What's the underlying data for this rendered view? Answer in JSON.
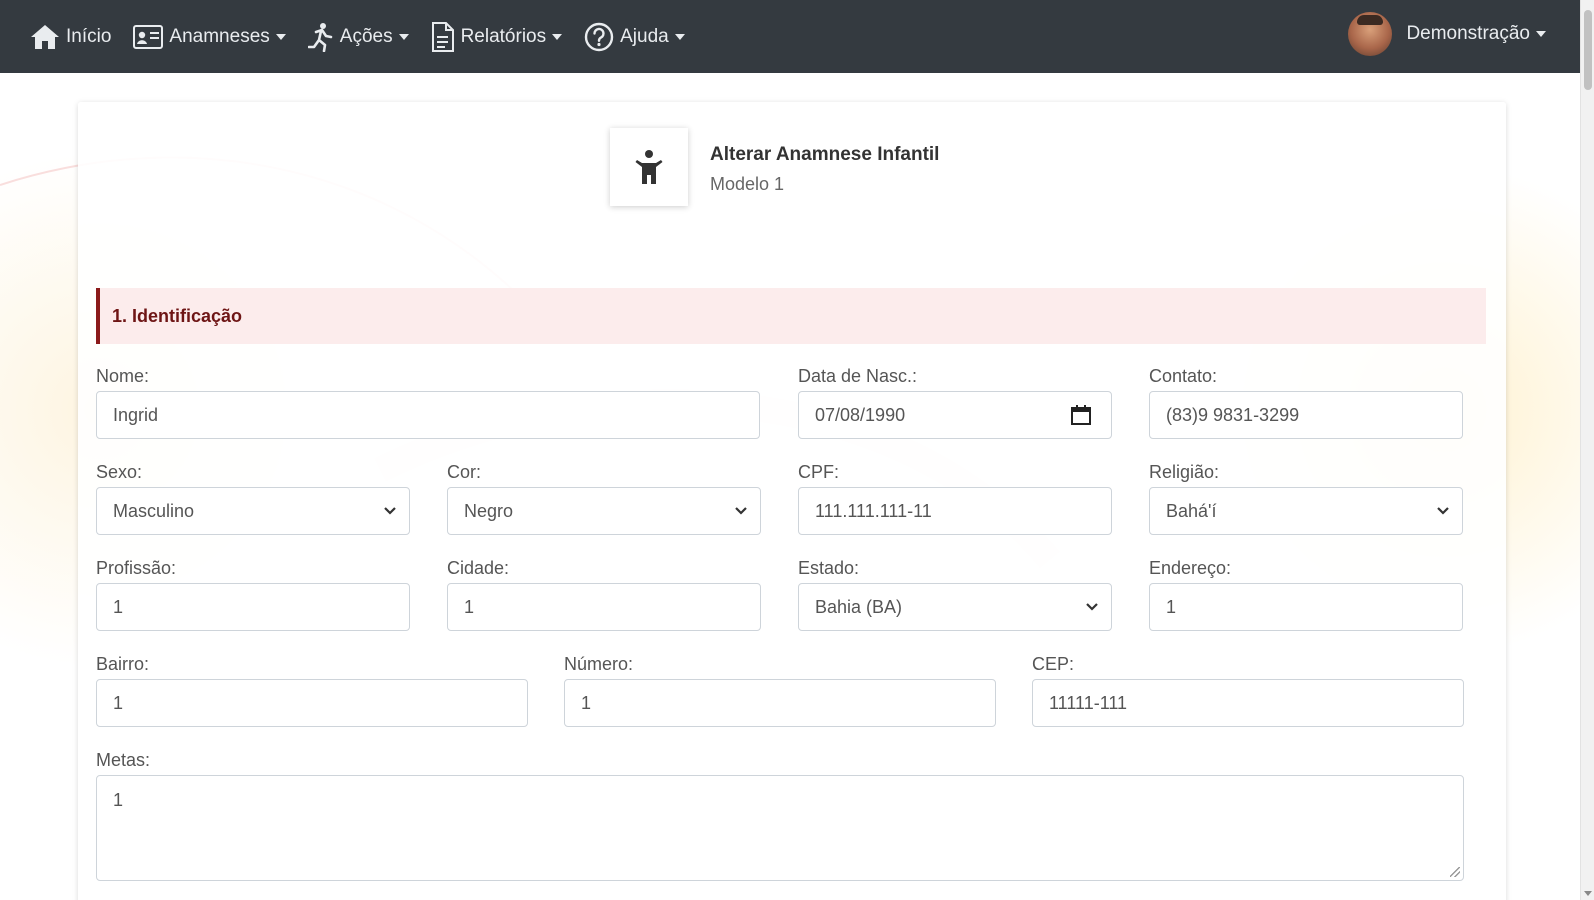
{
  "nav": {
    "items": [
      {
        "label": "Início",
        "icon": "home-icon",
        "dropdown": false
      },
      {
        "label": "Anamneses",
        "icon": "id-card-icon",
        "dropdown": true
      },
      {
        "label": "Ações",
        "icon": "running-icon",
        "dropdown": true
      },
      {
        "label": "Relatórios",
        "icon": "document-icon",
        "dropdown": true
      },
      {
        "label": "Ajuda",
        "icon": "help-circle-icon",
        "dropdown": true
      }
    ],
    "user": {
      "name": "Demonstração"
    }
  },
  "header": {
    "title": "Alterar Anamnese Infantil",
    "subtitle": "Modelo 1",
    "icon": "child-icon"
  },
  "section": {
    "title": "1. Identificação"
  },
  "form": {
    "nome": {
      "label": "Nome:",
      "value": "Ingrid"
    },
    "data_nasc": {
      "label": "Data de Nasc.:",
      "value": "07/08/1990"
    },
    "contato": {
      "label": "Contato:",
      "value": "(83)9 9831-3299"
    },
    "sexo": {
      "label": "Sexo:",
      "value": "Masculino"
    },
    "cor": {
      "label": "Cor:",
      "value": "Negro"
    },
    "cpf": {
      "label": "CPF:",
      "value": "111.111.111-11"
    },
    "religiao": {
      "label": "Religião:",
      "value": "Bahá'í"
    },
    "profissao": {
      "label": "Profissão:",
      "value": "1"
    },
    "cidade": {
      "label": "Cidade:",
      "value": "1"
    },
    "estado": {
      "label": "Estado:",
      "value": "Bahia (BA)"
    },
    "endereco": {
      "label": "Endereço:",
      "value": "1"
    },
    "bairro": {
      "label": "Bairro:",
      "value": "1"
    },
    "numero": {
      "label": "Número:",
      "value": "1"
    },
    "cep": {
      "label": "CEP:",
      "value": "11111-111"
    },
    "metas": {
      "label": "Metas:",
      "value": "1"
    }
  },
  "colors": {
    "navbar": "#343a40",
    "section_bg": "#fcecec",
    "section_accent": "#8b1a1a"
  }
}
